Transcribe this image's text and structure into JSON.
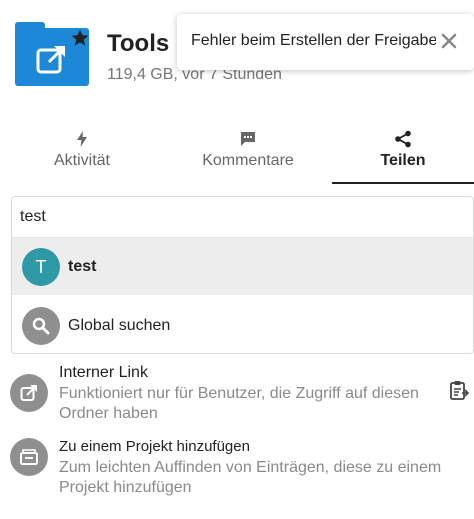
{
  "header": {
    "title": "Tools",
    "subtitle": "119,4 GB, vor 7 Stunden",
    "folder_color": "#1e88d8"
  },
  "toast": {
    "message": "Fehler beim Erstellen der Freigabe"
  },
  "tabs": [
    {
      "label": "Aktivität",
      "icon": "activity-icon",
      "active": false
    },
    {
      "label": "Kommentare",
      "icon": "comment-icon",
      "active": false
    },
    {
      "label": "Teilen",
      "icon": "share-icon",
      "active": true
    }
  ],
  "search": {
    "value": "test",
    "results": [
      {
        "avatar_letter": "T",
        "label": "test",
        "avatar_color": "#2e9aa8"
      },
      {
        "label": "Global suchen",
        "icon": "search-icon"
      }
    ]
  },
  "internal_link": {
    "title": "Interner Link",
    "description": "Funktioniert nur für Benutzer, die Zugriff auf diesen Ordner haben"
  },
  "project": {
    "title": "Zu einem Projekt hinzufügen",
    "description": "Zum leichten Auffinden von Einträgen, diese zu einem Projekt hinzufügen"
  }
}
